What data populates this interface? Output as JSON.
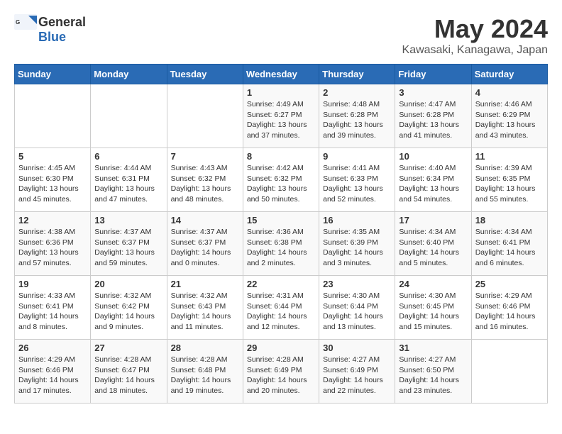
{
  "logo": {
    "general": "General",
    "blue": "Blue"
  },
  "title": {
    "month_year": "May 2024",
    "location": "Kawasaki, Kanagawa, Japan"
  },
  "days_of_week": [
    "Sunday",
    "Monday",
    "Tuesday",
    "Wednesday",
    "Thursday",
    "Friday",
    "Saturday"
  ],
  "weeks": [
    [
      {
        "day": "",
        "info": ""
      },
      {
        "day": "",
        "info": ""
      },
      {
        "day": "",
        "info": ""
      },
      {
        "day": "1",
        "info": "Sunrise: 4:49 AM\nSunset: 6:27 PM\nDaylight: 13 hours and 37 minutes."
      },
      {
        "day": "2",
        "info": "Sunrise: 4:48 AM\nSunset: 6:28 PM\nDaylight: 13 hours and 39 minutes."
      },
      {
        "day": "3",
        "info": "Sunrise: 4:47 AM\nSunset: 6:28 PM\nDaylight: 13 hours and 41 minutes."
      },
      {
        "day": "4",
        "info": "Sunrise: 4:46 AM\nSunset: 6:29 PM\nDaylight: 13 hours and 43 minutes."
      }
    ],
    [
      {
        "day": "5",
        "info": "Sunrise: 4:45 AM\nSunset: 6:30 PM\nDaylight: 13 hours and 45 minutes."
      },
      {
        "day": "6",
        "info": "Sunrise: 4:44 AM\nSunset: 6:31 PM\nDaylight: 13 hours and 47 minutes."
      },
      {
        "day": "7",
        "info": "Sunrise: 4:43 AM\nSunset: 6:32 PM\nDaylight: 13 hours and 48 minutes."
      },
      {
        "day": "8",
        "info": "Sunrise: 4:42 AM\nSunset: 6:32 PM\nDaylight: 13 hours and 50 minutes."
      },
      {
        "day": "9",
        "info": "Sunrise: 4:41 AM\nSunset: 6:33 PM\nDaylight: 13 hours and 52 minutes."
      },
      {
        "day": "10",
        "info": "Sunrise: 4:40 AM\nSunset: 6:34 PM\nDaylight: 13 hours and 54 minutes."
      },
      {
        "day": "11",
        "info": "Sunrise: 4:39 AM\nSunset: 6:35 PM\nDaylight: 13 hours and 55 minutes."
      }
    ],
    [
      {
        "day": "12",
        "info": "Sunrise: 4:38 AM\nSunset: 6:36 PM\nDaylight: 13 hours and 57 minutes."
      },
      {
        "day": "13",
        "info": "Sunrise: 4:37 AM\nSunset: 6:37 PM\nDaylight: 13 hours and 59 minutes."
      },
      {
        "day": "14",
        "info": "Sunrise: 4:37 AM\nSunset: 6:37 PM\nDaylight: 14 hours and 0 minutes."
      },
      {
        "day": "15",
        "info": "Sunrise: 4:36 AM\nSunset: 6:38 PM\nDaylight: 14 hours and 2 minutes."
      },
      {
        "day": "16",
        "info": "Sunrise: 4:35 AM\nSunset: 6:39 PM\nDaylight: 14 hours and 3 minutes."
      },
      {
        "day": "17",
        "info": "Sunrise: 4:34 AM\nSunset: 6:40 PM\nDaylight: 14 hours and 5 minutes."
      },
      {
        "day": "18",
        "info": "Sunrise: 4:34 AM\nSunset: 6:41 PM\nDaylight: 14 hours and 6 minutes."
      }
    ],
    [
      {
        "day": "19",
        "info": "Sunrise: 4:33 AM\nSunset: 6:41 PM\nDaylight: 14 hours and 8 minutes."
      },
      {
        "day": "20",
        "info": "Sunrise: 4:32 AM\nSunset: 6:42 PM\nDaylight: 14 hours and 9 minutes."
      },
      {
        "day": "21",
        "info": "Sunrise: 4:32 AM\nSunset: 6:43 PM\nDaylight: 14 hours and 11 minutes."
      },
      {
        "day": "22",
        "info": "Sunrise: 4:31 AM\nSunset: 6:44 PM\nDaylight: 14 hours and 12 minutes."
      },
      {
        "day": "23",
        "info": "Sunrise: 4:30 AM\nSunset: 6:44 PM\nDaylight: 14 hours and 13 minutes."
      },
      {
        "day": "24",
        "info": "Sunrise: 4:30 AM\nSunset: 6:45 PM\nDaylight: 14 hours and 15 minutes."
      },
      {
        "day": "25",
        "info": "Sunrise: 4:29 AM\nSunset: 6:46 PM\nDaylight: 14 hours and 16 minutes."
      }
    ],
    [
      {
        "day": "26",
        "info": "Sunrise: 4:29 AM\nSunset: 6:46 PM\nDaylight: 14 hours and 17 minutes."
      },
      {
        "day": "27",
        "info": "Sunrise: 4:28 AM\nSunset: 6:47 PM\nDaylight: 14 hours and 18 minutes."
      },
      {
        "day": "28",
        "info": "Sunrise: 4:28 AM\nSunset: 6:48 PM\nDaylight: 14 hours and 19 minutes."
      },
      {
        "day": "29",
        "info": "Sunrise: 4:28 AM\nSunset: 6:49 PM\nDaylight: 14 hours and 20 minutes."
      },
      {
        "day": "30",
        "info": "Sunrise: 4:27 AM\nSunset: 6:49 PM\nDaylight: 14 hours and 22 minutes."
      },
      {
        "day": "31",
        "info": "Sunrise: 4:27 AM\nSunset: 6:50 PM\nDaylight: 14 hours and 23 minutes."
      },
      {
        "day": "",
        "info": ""
      }
    ]
  ]
}
